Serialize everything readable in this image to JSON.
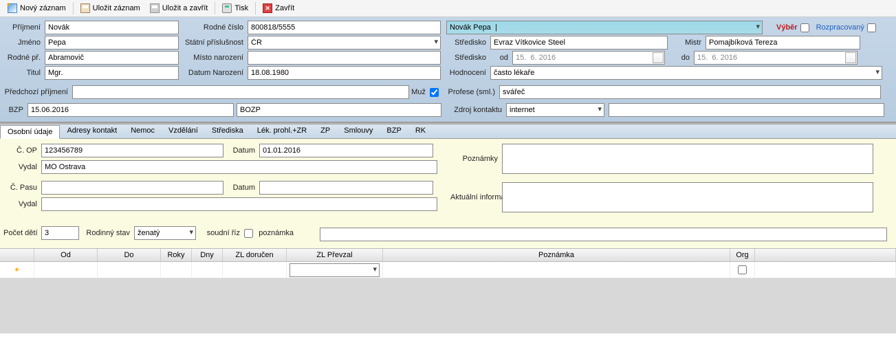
{
  "toolbar": {
    "new": "Nový záznam",
    "save": "Uložit záznam",
    "saveClose": "Uložit a zavřít",
    "print": "Tisk",
    "close": "Zavřít"
  },
  "labels": {
    "prijmeni": "Příjmení",
    "jmeno": "Jméno",
    "rodnePr": "Rodné př.",
    "titul": "Titul",
    "rodneCislo": "Rodné číslo",
    "statniPrisl": "Státní příslušnost",
    "mistoNar": "Místo narození",
    "datumNar": "Datum Narození",
    "predchoziPrij": "Předchozí příjmení",
    "muz": "Muž",
    "bzp": "BZP",
    "vyber": "Výběr",
    "rozpracovany": "Rozpracovaný",
    "stredisko": "Středisko",
    "strediskoOd": "od",
    "strediskoDo": "do",
    "hodnoceni": "Hodnocení",
    "profese": "Profese (sml.)",
    "zdrojKontaktu": "Zdroj kontaktu",
    "mistr": "Mistr",
    "cOP": "Č. OP",
    "vydal": "Vydal",
    "cPasu": "Č. Pasu",
    "datum": "Datum",
    "pocetDeti": "Počet dětí",
    "rodinnyStav": "Rodinný stav",
    "soudniRiz": "soudní říz",
    "poznamka": "poznámka",
    "poznamky": "Poznámky",
    "aktualniInfo": "Aktuální informace"
  },
  "vals": {
    "prijmeni": "Novák",
    "jmeno": "Pepa",
    "rodnePr": "Abramovič",
    "titul": "Mgr.",
    "rodneCislo": "800818/5555",
    "statniPrisl": "ČR",
    "mistoNar": "",
    "datumNar": "18.08.1980",
    "predchoziPrij": "",
    "muz": true,
    "bzpDate": "15.06.2016",
    "bzpType": "BOZP",
    "personCombo": "Novák Pepa  |",
    "vyber": false,
    "rozpracovany": false,
    "stredisko": "Evraz Vítkovice Steel",
    "strediskoOd": "15.  6. 2016",
    "strediskoDo": "15.  6. 2016",
    "hodnoceni": "často lékaře",
    "profese": "svářeč",
    "zdrojKontaktu": "internet",
    "zdrojKontaktuExtra": "",
    "mistr": "Pomajbíková Tereza",
    "cOP": "123456789",
    "opDatum": "01.01.2016",
    "opVydal": "MO Ostrava",
    "cPasu": "",
    "pasDatum": "",
    "pasVydal": "",
    "pocetDeti": "3",
    "rodinnyStav": "ženatý",
    "soudniRiz": false,
    "poznMid": ""
  },
  "tabs": [
    "Osobní údaje",
    "Adresy kontakt",
    "Nemoc",
    "Vzdělání",
    "Střediska",
    "Lék. prohl.+ZR",
    "ZP",
    "Smlouvy",
    "BZP",
    "RK"
  ],
  "activeTab": 0,
  "gridCols": [
    "",
    "Od",
    "Do",
    "Roky",
    "Dny",
    "ZL doručen",
    "ZL Převzal",
    "Poznámka",
    "Org",
    ""
  ],
  "gridWidths": [
    50,
    92,
    92,
    45,
    45,
    93,
    140,
    490,
    30,
    210
  ]
}
